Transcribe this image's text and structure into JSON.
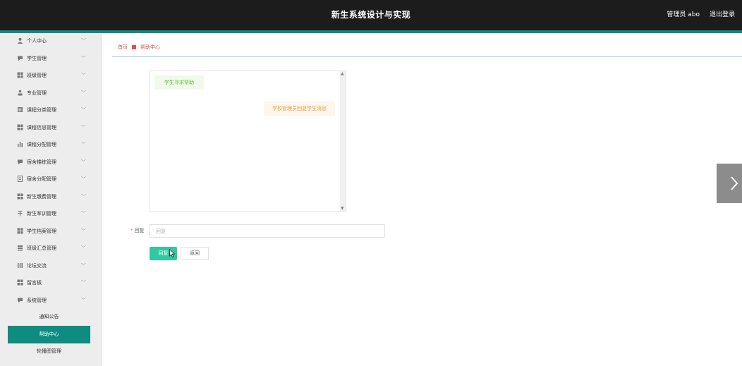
{
  "header": {
    "title": "新生系统设计与实现",
    "user": "管理员 abo",
    "logout": "退出登录"
  },
  "sidebar": {
    "items": [
      {
        "label": "个人中心",
        "icon": "user-icon"
      },
      {
        "label": "学生管理",
        "icon": "chat-icon"
      },
      {
        "label": "班级管理",
        "icon": "grid-icon"
      },
      {
        "label": "专业管理",
        "icon": "person-icon"
      },
      {
        "label": "课程分类管理",
        "icon": "bar-icon"
      },
      {
        "label": "课程信息管理",
        "icon": "grid-icon"
      },
      {
        "label": "课程分配管理",
        "icon": "chart-icon"
      },
      {
        "label": "宿舍楼栋管理",
        "icon": "chat-icon"
      },
      {
        "label": "宿舍分配管理",
        "icon": "doc-icon"
      },
      {
        "label": "新生缴费管理",
        "icon": "grid-icon"
      },
      {
        "label": "新生军训管理",
        "icon": "flag-icon"
      },
      {
        "label": "学生档案管理",
        "icon": "grid-icon"
      },
      {
        "label": "班级汇总管理",
        "icon": "stack-icon"
      },
      {
        "label": "论坛交流",
        "icon": "list-icon"
      },
      {
        "label": "留言板",
        "icon": "grid-icon"
      },
      {
        "label": "系统管理",
        "icon": "chat-icon"
      }
    ],
    "subitems": [
      {
        "label": "通知公告"
      },
      {
        "label": "帮助中心"
      },
      {
        "label": "轮播图管理"
      }
    ]
  },
  "breadcrumb": {
    "home": "首页",
    "current": "帮助中心"
  },
  "chat": {
    "user_message": "学生寻求帮助",
    "admin_message": "学校管理员回复学生消息"
  },
  "form": {
    "reply_label": "回复",
    "required_mark": "*",
    "reply_placeholder": "回复",
    "submit_label": "回复",
    "back_label": "返回"
  },
  "colors": {
    "topbar": "#1c1c1c",
    "accent": "#0e8c80",
    "primary_button": "#30c9a0",
    "breadcrumb": "#d9534f"
  }
}
